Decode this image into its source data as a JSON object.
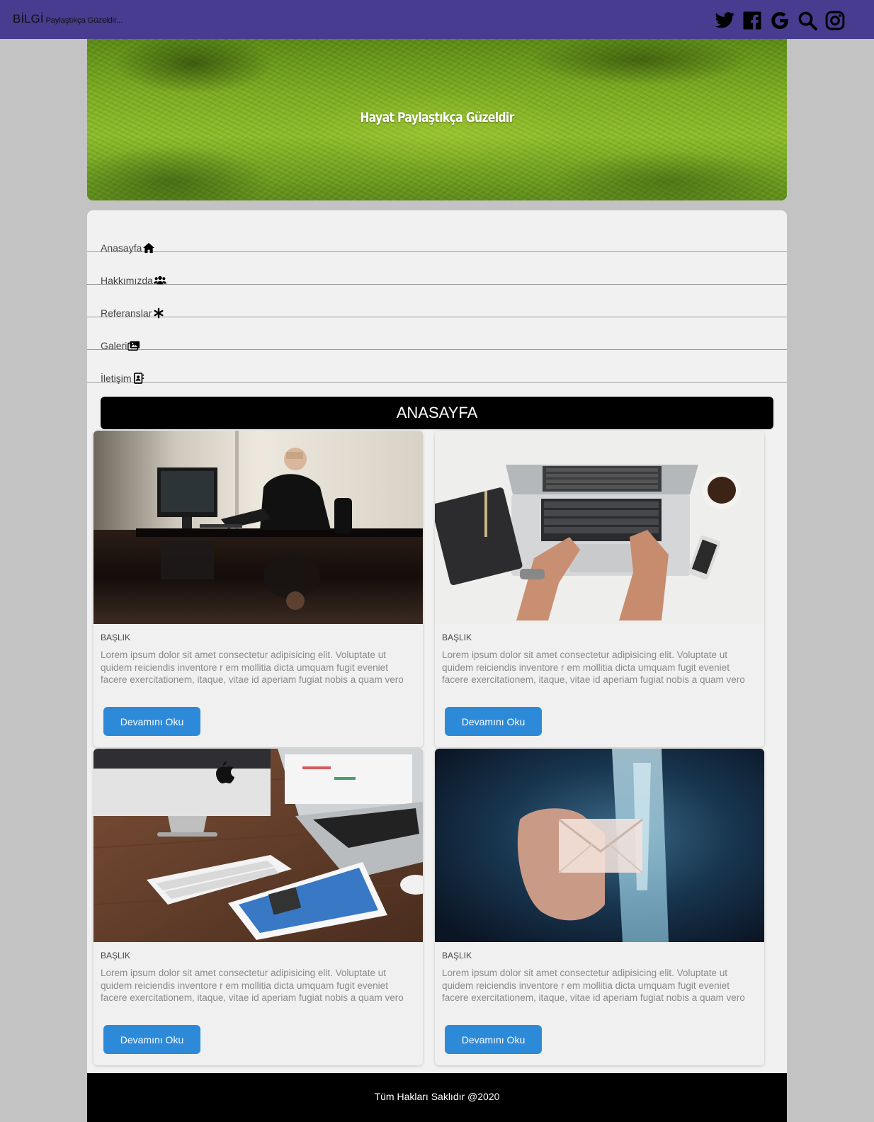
{
  "navbar": {
    "brand": "BİLGİ",
    "tagline": "Paylaştıkça Güzeldir...",
    "social_icons": [
      "twitter-icon",
      "facebook-icon",
      "google-icon",
      "search-icon",
      "instagram-icon"
    ],
    "background_color": "#473c8f"
  },
  "hero": {
    "title": "Hayat Paylaştıkça Güzeldir"
  },
  "menu": {
    "items": [
      {
        "label": "Anasayfa",
        "icon": "home-icon"
      },
      {
        "label": "Hakkımızda",
        "icon": "users-icon"
      },
      {
        "label": "Referanslar",
        "icon": "asterisk-icon"
      },
      {
        "label": "Galeri",
        "icon": "images-icon"
      },
      {
        "label": "İletişim",
        "icon": "contact-card-icon"
      }
    ]
  },
  "section": {
    "title": "ANASAYFA"
  },
  "cards": [
    {
      "heading": "BAŞLIK",
      "text": "Lorem ipsum dolor sit amet consectetur adipisicing elit. Voluptate ut quidem reiciendis inventore r em mollitia dicta umquam fugit eveniet facere exercitationem, itaque, vitae id aperiam fugiat nobis a quam vero",
      "button": "Devamını Oku"
    },
    {
      "heading": "BAŞLIK",
      "text": "Lorem ipsum dolor sit amet consectetur adipisicing elit. Voluptate ut quidem reiciendis inventore r em mollitia dicta umquam fugit eveniet facere exercitationem, itaque, vitae id aperiam fugiat nobis a quam vero",
      "button": "Devamını Oku"
    },
    {
      "heading": "BAŞLIK",
      "text": "Lorem ipsum dolor sit amet consectetur adipisicing elit. Voluptate ut quidem reiciendis inventore r em mollitia dicta umquam fugit eveniet facere exercitationem, itaque, vitae id aperiam fugiat nobis a quam vero",
      "button": "Devamını Oku"
    },
    {
      "heading": "BAŞLIK",
      "text": "Lorem ipsum dolor sit amet consectetur adipisicing elit. Voluptate ut quidem reiciendis inventore r em mollitia dicta umquam fugit eveniet facere exercitationem, itaque, vitae id aperiam fugiat nobis a quam vero",
      "button": "Devamını Oku"
    }
  ],
  "footer": {
    "text": "Tüm Hakları Saklıdır @2020"
  },
  "colors": {
    "button": "#2d8ad8",
    "page_background": "#c3c3c3"
  }
}
